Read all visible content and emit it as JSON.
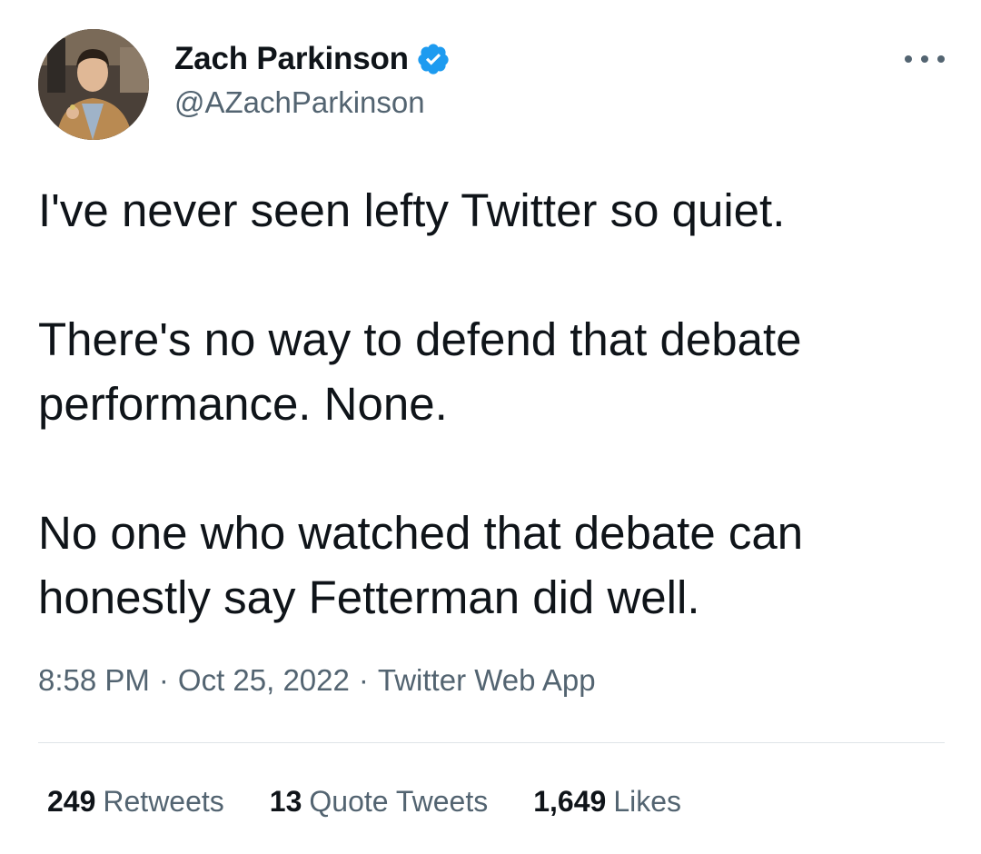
{
  "author": {
    "name": "Zach Parkinson",
    "handle": "@AZachParkinson",
    "verified_icon": "verified-badge-icon"
  },
  "tweet": {
    "paragraphs": [
      "I've never seen lefty Twitter so quiet.",
      "There's no way to defend that debate performance. None.",
      "No one who watched that debate can honestly say Fetterman did well."
    ]
  },
  "meta": {
    "time": "8:58 PM",
    "date": "Oct 25, 2022",
    "source": "Twitter Web App",
    "separator": "·"
  },
  "stats": {
    "retweets_count": "249",
    "retweets_label": "Retweets",
    "quotes_count": "13",
    "quotes_label": "Quote Tweets",
    "likes_count": "1,649",
    "likes_label": "Likes"
  },
  "colors": {
    "text_primary": "#0f1419",
    "text_secondary": "#536471",
    "verified_blue": "#1d9bf0",
    "divider": "#dfe4e8"
  }
}
